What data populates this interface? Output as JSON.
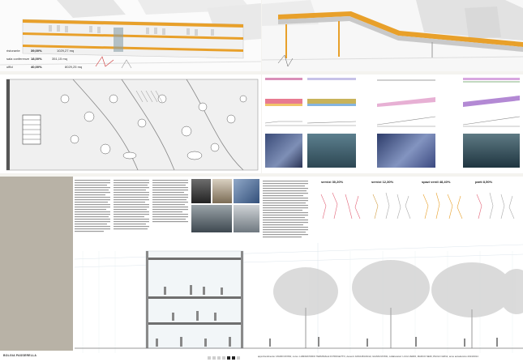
{
  "colors": {
    "orange": "#e8a02a",
    "band": "#b8b2a6",
    "panel_bg": "#ffffff"
  },
  "area_table": [
    {
      "label": "ristorante",
      "pct": "39,00%",
      "value": "1029,27 mq"
    },
    {
      "label": "sala conferenze",
      "pct": "18,00%",
      "value": "351,15 mq"
    },
    {
      "label": "uffici",
      "pct": "40,00%",
      "value": "8029,25 mq"
    }
  ],
  "function_shares": [
    {
      "label": "servizi",
      "pct": "30,20%"
    },
    {
      "label": "servizi",
      "pct": "12,30%"
    },
    {
      "label": "spazi verdi",
      "pct": "48,40%"
    },
    {
      "label": "parti",
      "pct": "8,50%"
    }
  ],
  "footer": {
    "logo_text": "BOLGIA PASSERELLA",
    "credits_text": "approfondimento: MARIO ROSSI; corso: LABORATORIO TERMINALE DI PROGETTO, docenti: ANNA BIANCHI, GIANNI ROSSI; collaboratori: LUCA VERDI, MARCO NERI, PAOLO GRIGI; anno accademico 2013/2014"
  },
  "dots": [
    "light",
    "light",
    "light",
    "light",
    "dark",
    "dark",
    "light"
  ]
}
